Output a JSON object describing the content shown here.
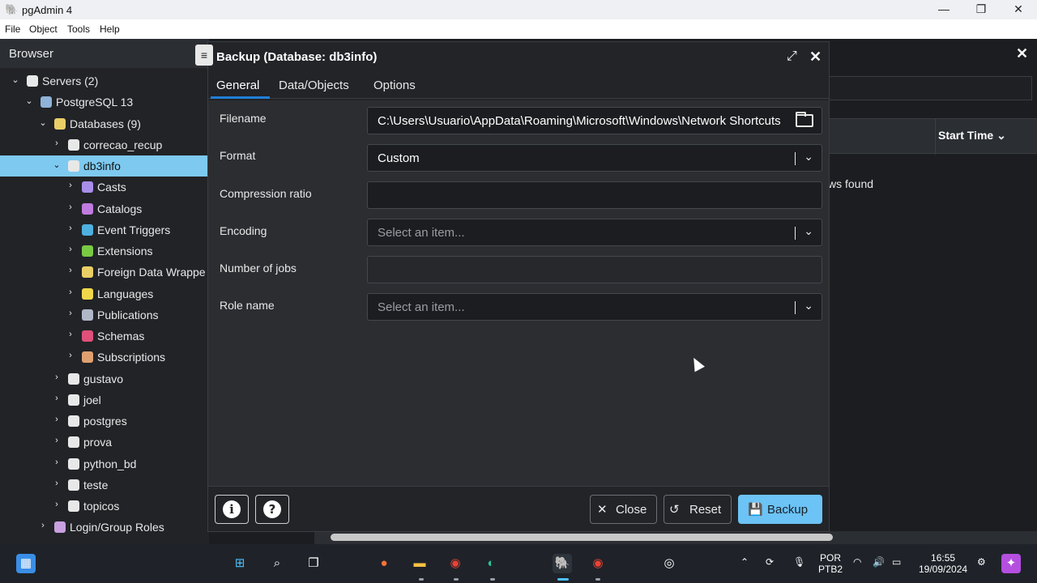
{
  "window": {
    "title": "pgAdmin 4",
    "controls": [
      "minimize",
      "restore",
      "close"
    ]
  },
  "menu": [
    "File",
    "Object",
    "Tools",
    "Help"
  ],
  "browser": {
    "title": "Browser",
    "tree": [
      {
        "label": "Servers (2)",
        "expanded": true,
        "icon": "servers-icon"
      },
      {
        "label": "PostgreSQL 13",
        "expanded": true,
        "icon": "postgres-server-icon"
      },
      {
        "label": "Databases (9)",
        "expanded": true,
        "icon": "databases-icon"
      },
      {
        "label": "correcao_recup",
        "expanded": false,
        "icon": "database-icon"
      },
      {
        "label": "db3info",
        "expanded": true,
        "selected": true,
        "icon": "database-icon"
      },
      {
        "label": "Casts",
        "expanded": false,
        "icon": "casts-icon"
      },
      {
        "label": "Catalogs",
        "expanded": false,
        "icon": "catalogs-icon"
      },
      {
        "label": "Event Triggers",
        "expanded": false,
        "icon": "event-triggers-icon"
      },
      {
        "label": "Extensions",
        "expanded": false,
        "icon": "extensions-icon"
      },
      {
        "label": "Foreign Data Wrappe",
        "expanded": false,
        "icon": "foreign-data-wrappers-icon"
      },
      {
        "label": "Languages",
        "expanded": false,
        "icon": "languages-icon"
      },
      {
        "label": "Publications",
        "expanded": false,
        "icon": "publications-icon"
      },
      {
        "label": "Schemas",
        "expanded": false,
        "icon": "schemas-icon"
      },
      {
        "label": "Subscriptions",
        "expanded": false,
        "icon": "subscriptions-icon"
      },
      {
        "label": "gustavo",
        "expanded": false,
        "icon": "database-icon"
      },
      {
        "label": "joel",
        "expanded": false,
        "icon": "database-icon"
      },
      {
        "label": "postgres",
        "expanded": false,
        "icon": "database-icon"
      },
      {
        "label": "prova",
        "expanded": false,
        "icon": "database-icon"
      },
      {
        "label": "python_bd",
        "expanded": false,
        "icon": "database-icon"
      },
      {
        "label": "teste",
        "expanded": false,
        "icon": "database-icon"
      },
      {
        "label": "topicos",
        "expanded": false,
        "icon": "database-icon"
      },
      {
        "label": "Login/Group Roles",
        "expanded": false,
        "icon": "login-roles-icon"
      }
    ]
  },
  "right_panel": {
    "column_header": "Start Time",
    "empty_text": "ws found"
  },
  "dialog": {
    "title": "Backup (Database: db3info)",
    "tabs": [
      "General",
      "Data/Objects",
      "Options"
    ],
    "active_tab": "General",
    "fields": {
      "filename": {
        "label": "Filename",
        "value": "C:\\Users\\Usuario\\AppData\\Roaming\\Microsoft\\Windows\\Network Shortcuts"
      },
      "format": {
        "label": "Format",
        "value": "Custom"
      },
      "compression": {
        "label": "Compression ratio",
        "value": ""
      },
      "encoding": {
        "label": "Encoding",
        "placeholder": "Select an item..."
      },
      "jobs": {
        "label": "Number of jobs",
        "value": ""
      },
      "role": {
        "label": "Role name",
        "placeholder": "Select an item..."
      }
    },
    "buttons": {
      "info": "i",
      "help": "?",
      "close": "Close",
      "reset": "Reset",
      "backup": "Backup"
    }
  },
  "taskbar": {
    "language": "POR",
    "layout": "PTB2",
    "time": "16:55",
    "date": "19/09/2024"
  },
  "colors": {
    "accent": "#6cc3f5",
    "selection": "#7ec9f0",
    "tab_underline": "#1f7fd6"
  }
}
